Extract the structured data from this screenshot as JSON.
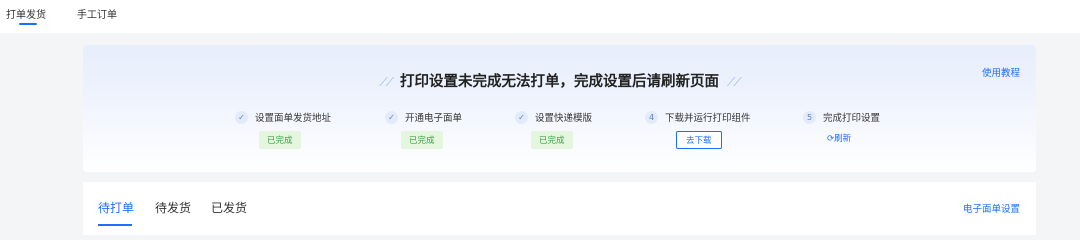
{
  "top_tabs": [
    {
      "label": "打单发货",
      "active": true
    },
    {
      "label": "手工订单",
      "active": false
    }
  ],
  "banner": {
    "title": "打印设置未完成无法打单，完成设置后请刷新页面",
    "tutorial_link": "使用教程",
    "steps": [
      {
        "marker": "✓",
        "label": "设置面单发货地址",
        "status": "已完成"
      },
      {
        "marker": "✓",
        "label": "开通电子面单",
        "status": "已完成"
      },
      {
        "marker": "✓",
        "label": "设置快递模版",
        "status": "已完成"
      },
      {
        "marker": "4",
        "label": "下载并运行打印组件",
        "action": "去下载"
      },
      {
        "marker": "5",
        "label": "完成打印设置",
        "action": "刷新"
      }
    ]
  },
  "order_tabs": [
    {
      "label": "待打单",
      "active": true
    },
    {
      "label": "待发货",
      "active": false
    },
    {
      "label": "已发货",
      "active": false
    }
  ],
  "waybill_settings_link": "电子面单设置",
  "colors": {
    "accent": "#1e6fff",
    "done_bg": "#e5f6df",
    "done_text": "#3aa34a"
  }
}
